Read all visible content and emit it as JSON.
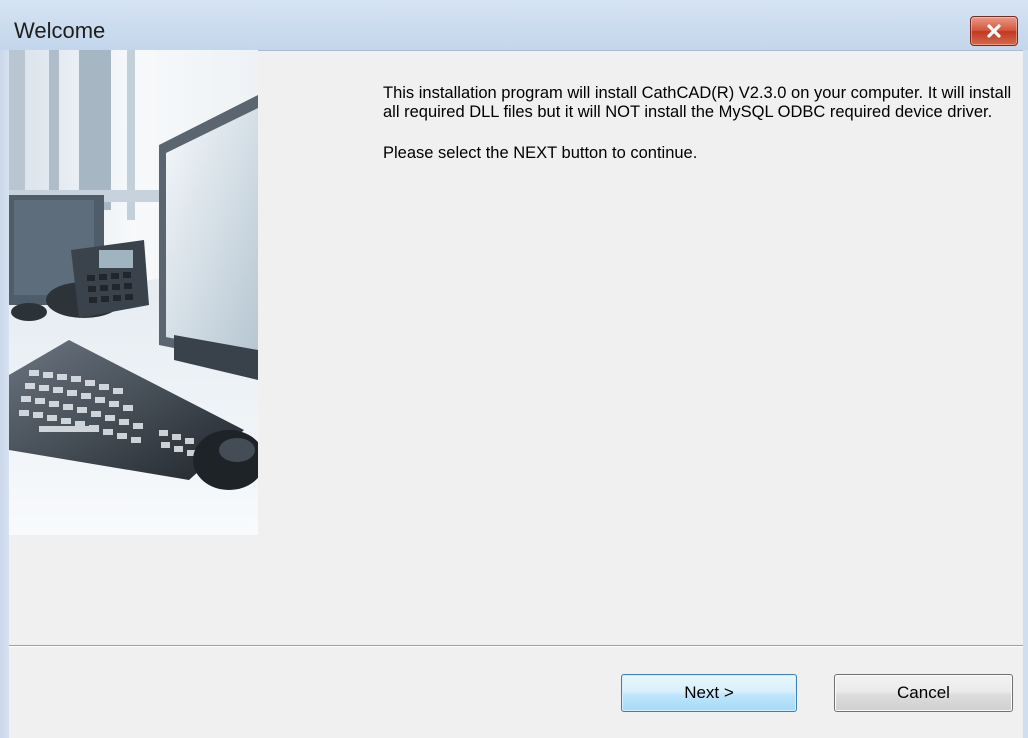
{
  "window": {
    "title": "Welcome"
  },
  "content": {
    "paragraph1": "This installation program will install CathCAD(R) V2.3.0 on your computer. It will install all required DLL files but it will NOT install the MySQL ODBC required device driver.",
    "paragraph2": "Please select the NEXT button to continue."
  },
  "buttons": {
    "next": "Next >",
    "cancel": "Cancel"
  },
  "image": {
    "description_icon": "office-desk-photo-icon"
  },
  "colors": {
    "titlebar": "#c9daee",
    "close_button": "#c9452c",
    "next_button_border": "#3c7fb1"
  }
}
